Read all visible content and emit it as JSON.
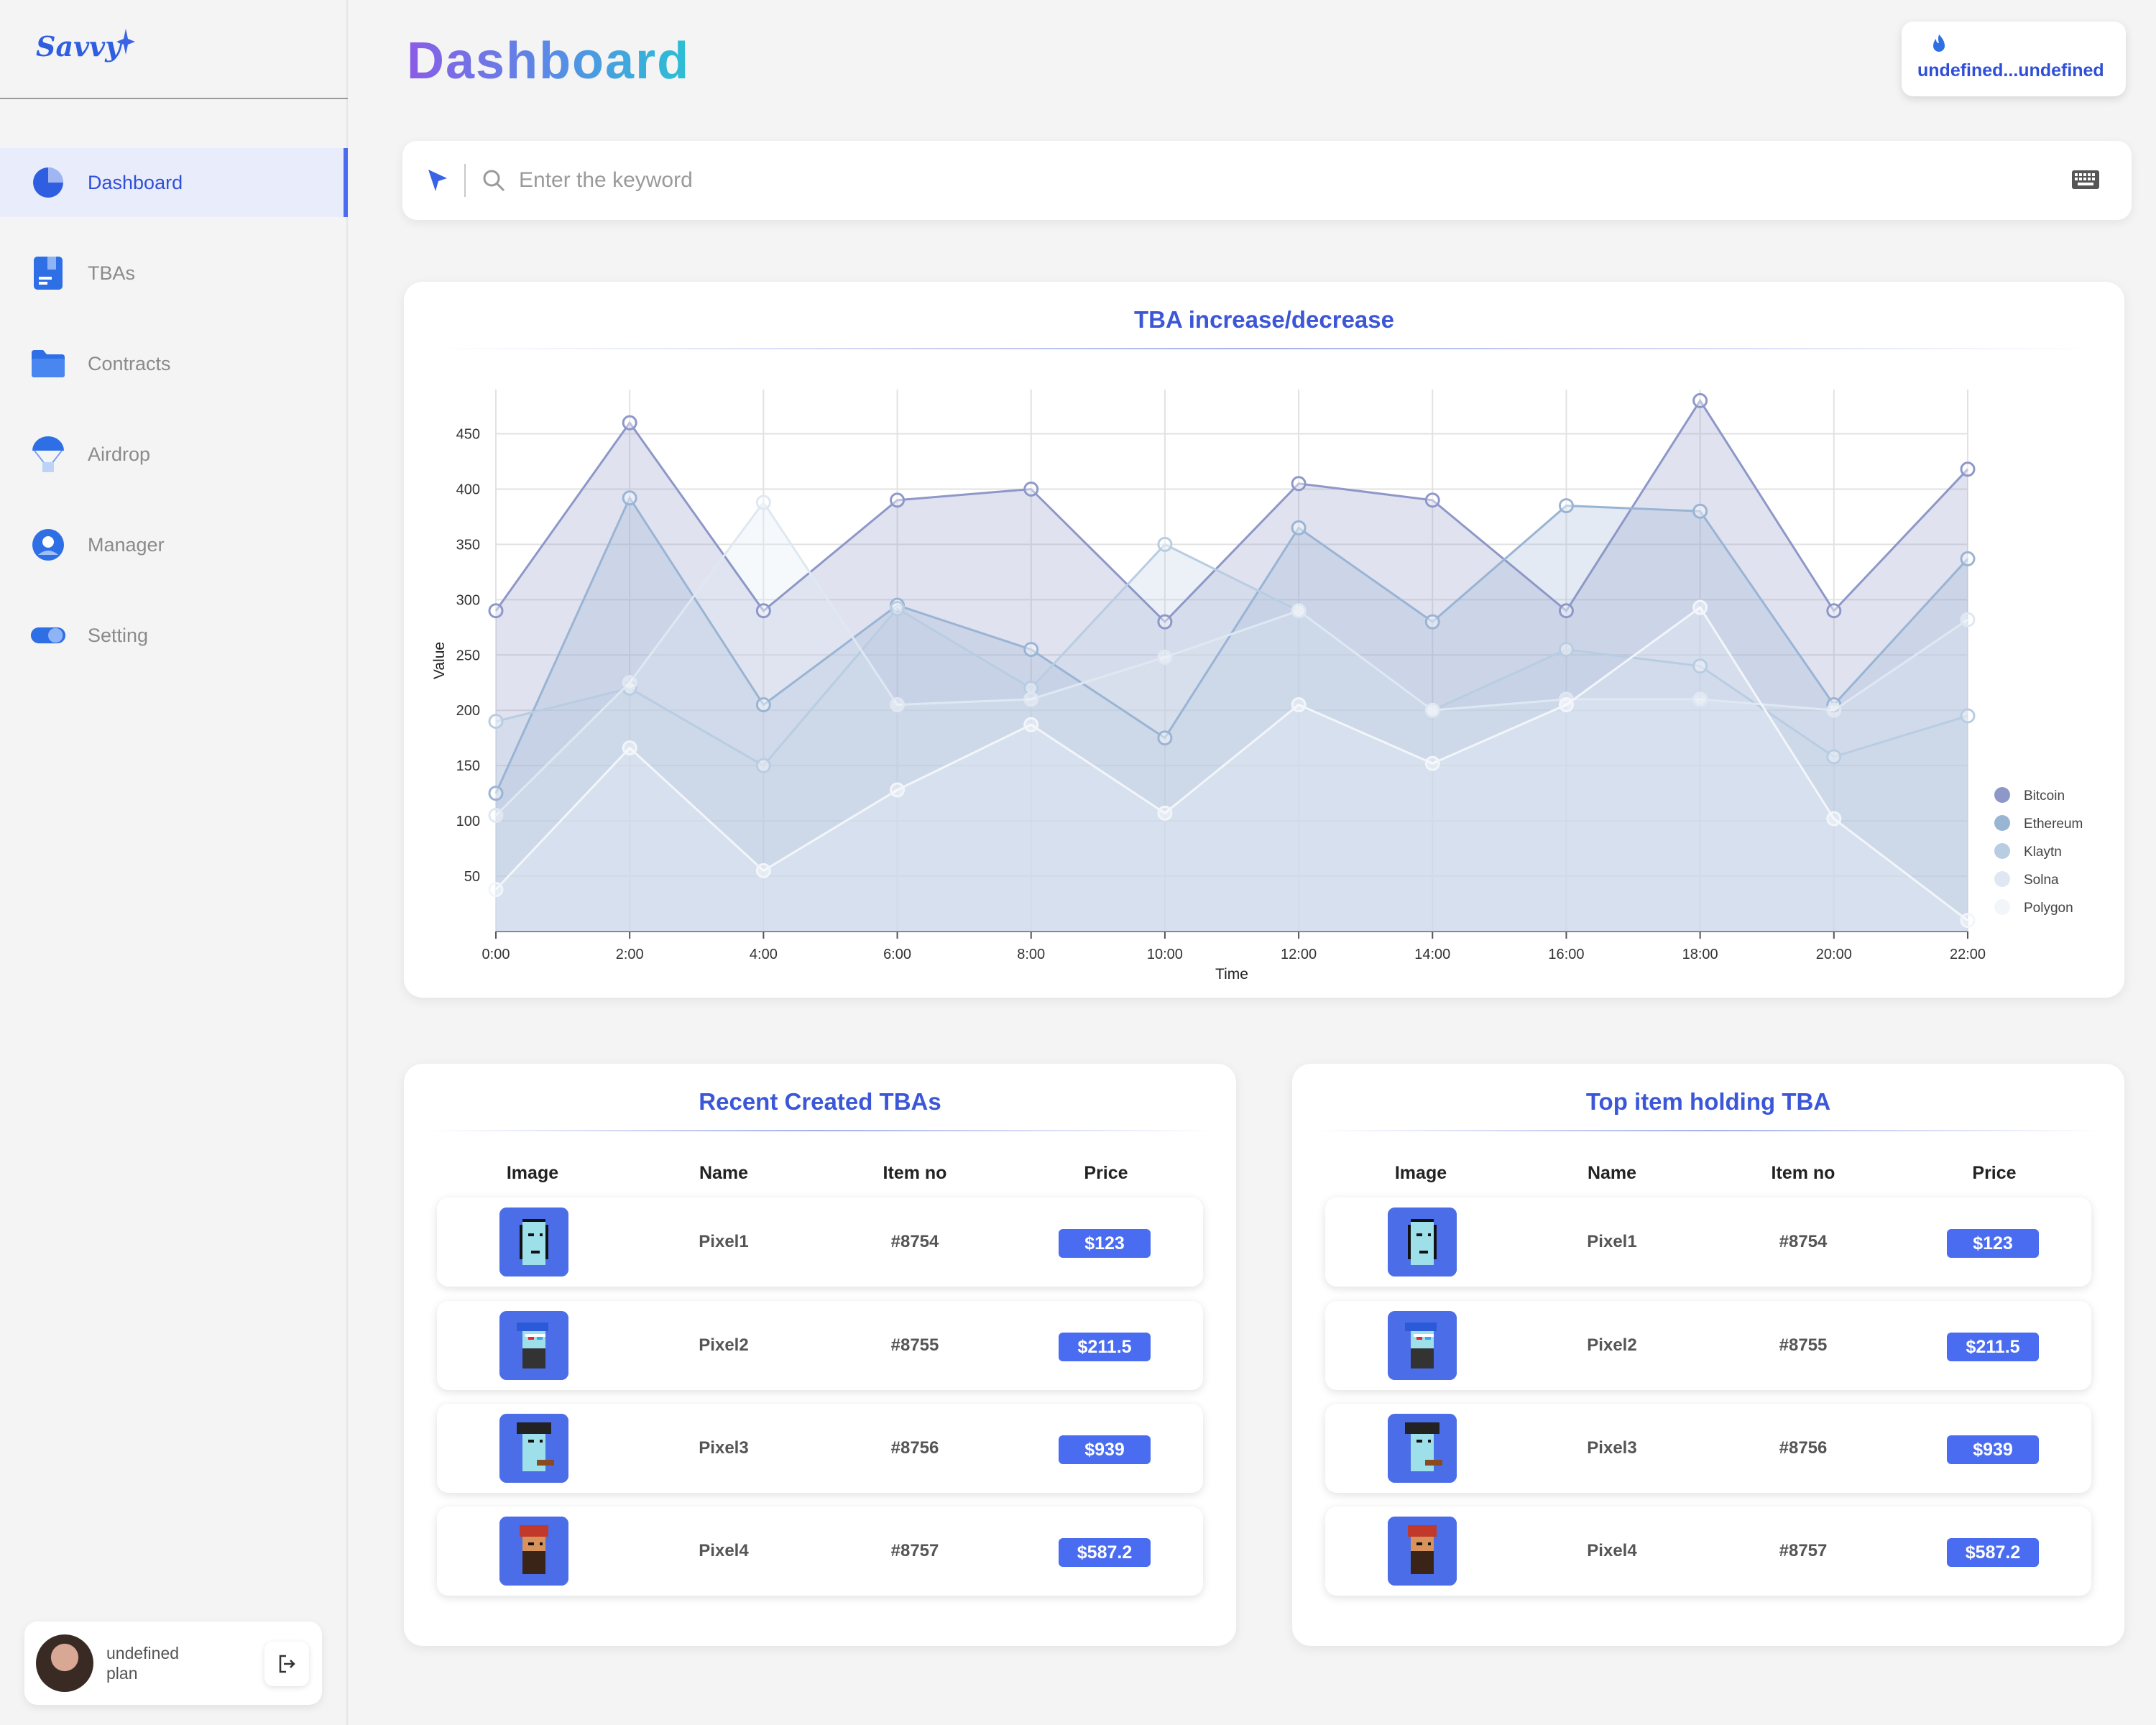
{
  "brand": {
    "logo_text": "Savvy"
  },
  "sidebar": {
    "items": [
      {
        "label": "Dashboard",
        "icon": "pie-chart-icon",
        "active": true
      },
      {
        "label": "TBAs",
        "icon": "document-icon",
        "active": false
      },
      {
        "label": "Contracts",
        "icon": "folder-icon",
        "active": false
      },
      {
        "label": "Airdrop",
        "icon": "parachute-icon",
        "active": false
      },
      {
        "label": "Manager",
        "icon": "user-circle-icon",
        "active": false
      },
      {
        "label": "Setting",
        "icon": "toggle-icon",
        "active": false
      }
    ],
    "user": {
      "name": "undefined",
      "plan": "plan"
    }
  },
  "header": {
    "title": "Dashboard",
    "wallet_text": "undefined...undefined"
  },
  "search": {
    "placeholder": "Enter the keyword"
  },
  "chart_card": {
    "title": "TBA increase/decrease"
  },
  "chart_data": {
    "type": "area",
    "title": "",
    "xlabel": "Time",
    "ylabel": "Value",
    "x": [
      "0:00",
      "2:00",
      "4:00",
      "6:00",
      "8:00",
      "10:00",
      "12:00",
      "14:00",
      "16:00",
      "18:00",
      "20:00",
      "22:00"
    ],
    "yticks": [
      50,
      100,
      150,
      200,
      250,
      300,
      350,
      400,
      450
    ],
    "ylim": [
      0,
      490
    ],
    "grid": true,
    "legend_position": "right",
    "series": [
      {
        "name": "Bitcoin",
        "color": "#8e98c8",
        "values": [
          290,
          460,
          290,
          390,
          400,
          280,
          405,
          390,
          290,
          480,
          290,
          418
        ]
      },
      {
        "name": "Ethereum",
        "color": "#9ab4d4",
        "values": [
          125,
          392,
          205,
          295,
          255,
          175,
          365,
          280,
          385,
          380,
          205,
          337
        ]
      },
      {
        "name": "Klaytn",
        "color": "#b9cde2",
        "values": [
          190,
          220,
          150,
          292,
          220,
          350,
          290,
          200,
          255,
          240,
          158,
          195
        ]
      },
      {
        "name": "Solna",
        "color": "#dfe8f2",
        "values": [
          105,
          225,
          388,
          205,
          210,
          248,
          290,
          200,
          210,
          210,
          200,
          282
        ]
      },
      {
        "name": "Polygon",
        "color": "#f2f6fa",
        "values": [
          38,
          166,
          55,
          128,
          187,
          107,
          205,
          152,
          205,
          293,
          102,
          10
        ]
      }
    ]
  },
  "tables": [
    {
      "title": "Recent Created TBAs",
      "columns": [
        "Image",
        "Name",
        "Item no",
        "Price"
      ],
      "rows": [
        {
          "name": "Pixel1",
          "item_no": "#8754",
          "price": "$123"
        },
        {
          "name": "Pixel2",
          "item_no": "#8755",
          "price": "$211.5"
        },
        {
          "name": "Pixel3",
          "item_no": "#8756",
          "price": "$939"
        },
        {
          "name": "Pixel4",
          "item_no": "#8757",
          "price": "$587.2"
        }
      ]
    },
    {
      "title": "Top item holding TBA",
      "columns": [
        "Image",
        "Name",
        "Item no",
        "Price"
      ],
      "rows": [
        {
          "name": "Pixel1",
          "item_no": "#8754",
          "price": "$123"
        },
        {
          "name": "Pixel2",
          "item_no": "#8755",
          "price": "$211.5"
        },
        {
          "name": "Pixel3",
          "item_no": "#8756",
          "price": "$939"
        },
        {
          "name": "Pixel4",
          "item_no": "#8757",
          "price": "$587.2"
        }
      ]
    }
  ]
}
